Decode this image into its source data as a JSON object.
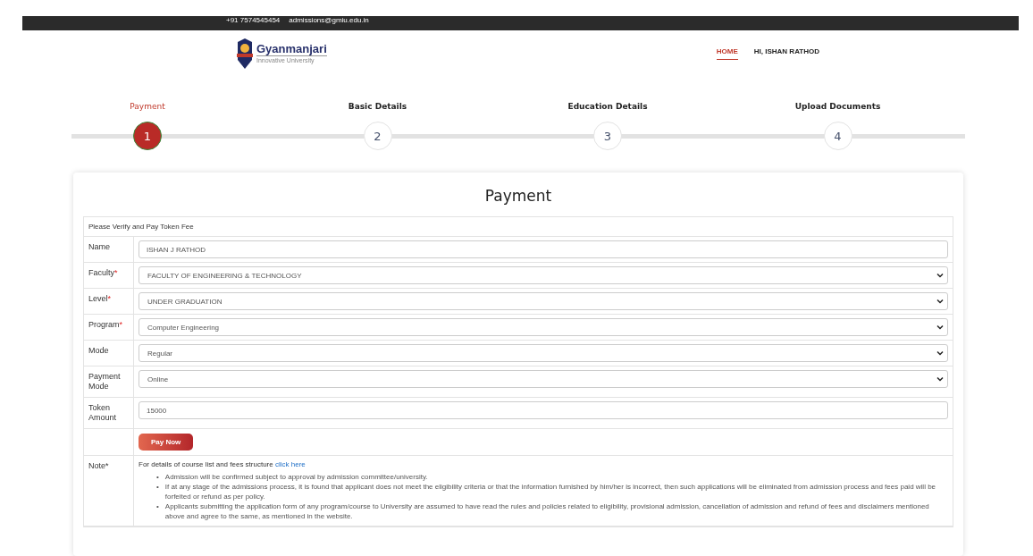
{
  "top_bar": {
    "phone": "+91 7574545454",
    "email": "admissions@gmiu.edu.in"
  },
  "logo": {
    "name": "Gyanmanjari",
    "tagline": "Innovative University"
  },
  "nav": [
    {
      "label": "HOME",
      "selected": true
    },
    {
      "label": "HI, ISHAN RATHOD",
      "selected": false
    }
  ],
  "steps": [
    {
      "label": "Payment",
      "number": "1",
      "selected": true
    },
    {
      "label": "Basic Details",
      "number": "2",
      "selected": false
    },
    {
      "label": "Education Details",
      "number": "3",
      "selected": false
    },
    {
      "label": "Upload Documents",
      "number": "4",
      "selected": false
    }
  ],
  "card": {
    "title": "Payment",
    "heading": "Please Verify and Pay Token Fee",
    "fields": [
      {
        "label": "Name",
        "kind": "text",
        "value": "ISHAN J RATHOD"
      },
      {
        "label": "Faculty",
        "required_mark": "*",
        "kind": "select",
        "value": "FACULTY OF ENGINEERING & TECHNOLOGY"
      },
      {
        "label": "Level",
        "required_mark": "*",
        "kind": "select",
        "value": "UNDER GRADUATION"
      },
      {
        "label": "Program",
        "required_mark": "*",
        "kind": "select",
        "value": "Computer Engineering"
      },
      {
        "label": "Mode",
        "kind": "select",
        "value": "Regular"
      },
      {
        "label": "Payment Mode",
        "kind": "select",
        "value": "Online"
      },
      {
        "label": "Token Amount",
        "kind": "text",
        "value": "15000"
      }
    ],
    "button": "Pay Now",
    "note": {
      "label": "Note*",
      "bullet": "•",
      "intro": "For details of course list and fees structure",
      "link": "click here",
      "items": [
        "Admission will be confirmed subject to approval by admission committee/university.",
        "If at any stage of the admissions process, it is found that applicant does not meet the eligibility criteria or that the information furnished by him/her is incorrect, then such applications will be eliminated from admission process and fees paid will be forfeited or refund as per policy.",
        "Applicants submitting the application form of any program/course to University are assumed to have read the rules and policies related to eligibility, provisional admission, cancellation of admission and refund of fees and disclaimers mentioned above and agree to the same, as mentioned in the website."
      ]
    }
  }
}
